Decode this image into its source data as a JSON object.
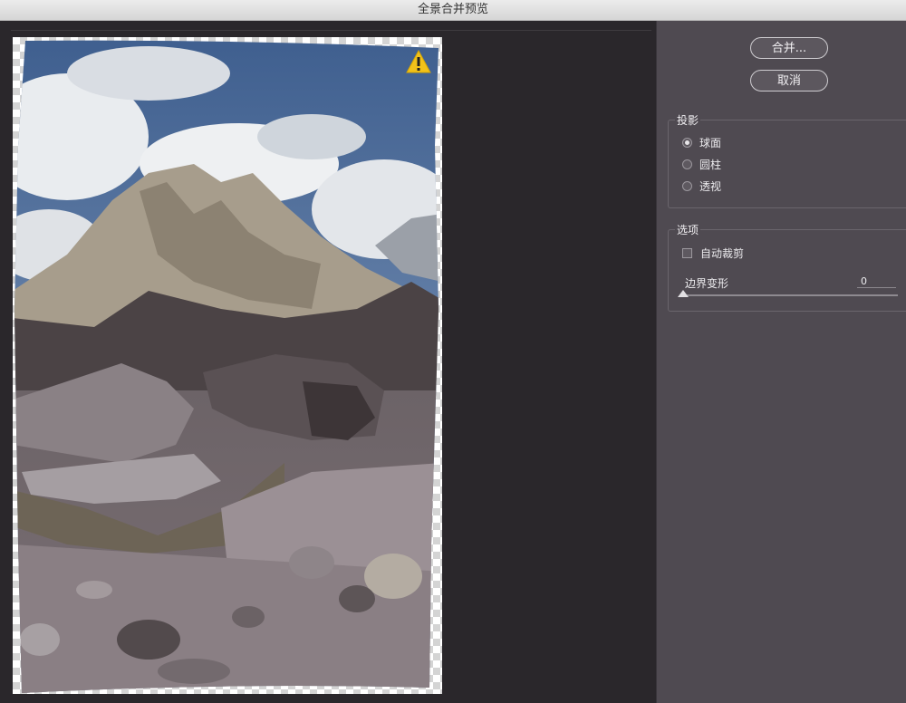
{
  "window": {
    "title": "全景合并预览"
  },
  "buttons": {
    "merge_label": "合并...",
    "cancel_label": "取消"
  },
  "projection": {
    "legend": "投影",
    "options": [
      {
        "label": "球面",
        "selected": true
      },
      {
        "label": "圆柱",
        "selected": false
      },
      {
        "label": "透视",
        "selected": false
      }
    ]
  },
  "options_group": {
    "legend": "选项",
    "auto_crop_label": "自动裁剪",
    "auto_crop_checked": false,
    "boundary_warp_label": "边界变形",
    "boundary_warp_value": "0"
  },
  "preview": {
    "warning_icon": "warning-triangle-icon"
  }
}
